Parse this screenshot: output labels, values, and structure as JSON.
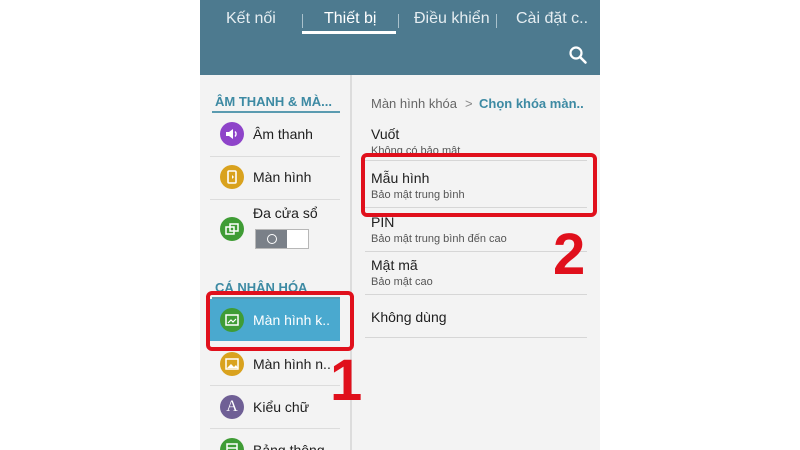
{
  "tabs": [
    {
      "label": "Kết nối"
    },
    {
      "label": "Thiết bị"
    },
    {
      "label": "Điều khiển"
    },
    {
      "label": "Cài đặt c.."
    }
  ],
  "search_icon": "search-icon",
  "left": {
    "section1": "ÂM THANH & MÀ...",
    "items1": [
      {
        "label": "Âm thanh",
        "icon": "volume-icon",
        "color": "#8e44c9"
      },
      {
        "label": "Màn hình",
        "icon": "display-icon",
        "color": "#d9a21e"
      },
      {
        "label": "Đa cửa sổ",
        "icon": "multi-window-icon",
        "color": "#3f9c35"
      }
    ],
    "section2": "CÁ NHÂN HÓA",
    "items2": [
      {
        "label": "Màn hình k..",
        "icon": "lock-screen-icon",
        "color": "#3f9c35"
      },
      {
        "label": "Màn hình n..",
        "icon": "wallpaper-icon",
        "color": "#d9a21e"
      },
      {
        "label": "Kiểu chữ",
        "icon": "font-icon",
        "color": "#6f5f95",
        "glyph": "A"
      },
      {
        "label": "Bảng thông...",
        "icon": "notification-panel-icon",
        "color": "#3f9c35"
      }
    ]
  },
  "breadcrumb": {
    "parent": "Màn hình khóa",
    "sep": ">",
    "current": "Chọn khóa màn.."
  },
  "options": [
    {
      "title": "Vuốt",
      "sub": "Không có bảo mật"
    },
    {
      "title": "Mẫu hình",
      "sub": "Bảo mật trung bình"
    },
    {
      "title": "PIN",
      "sub": "Bảo mật trung bình đến cao"
    },
    {
      "title": "Mật mã",
      "sub": "Bảo mật cao"
    },
    {
      "title": "Không dùng",
      "sub": ""
    }
  ],
  "annotations": {
    "step1": "1",
    "step2": "2",
    "color": "#e0101c"
  },
  "colors": {
    "topbar": "#4d7a8f",
    "section": "#3d8aa3",
    "selected": "#4aa9cf"
  }
}
